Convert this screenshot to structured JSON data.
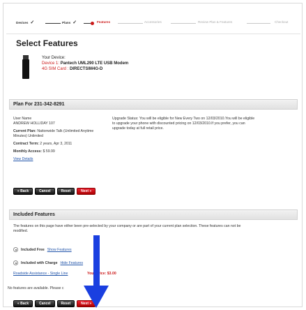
{
  "steps": [
    {
      "label": "Devices",
      "state": "done"
    },
    {
      "label": "Plans",
      "state": "done"
    },
    {
      "label": "Features",
      "state": "active"
    },
    {
      "label": "Accessories",
      "state": "inactive"
    },
    {
      "label": "Review Plan & Features",
      "state": "inactive"
    },
    {
      "label": "Checkout",
      "state": "inactive"
    }
  ],
  "page_title": "Select Features",
  "device": {
    "your_device_label": "Your Device:",
    "device_label": "Device 1:",
    "device_name": "Pantech UML290 LTE USB Modem",
    "sim_label": "4G SIM Card :",
    "sim_value": "DIRECTSIM4G-D"
  },
  "plan_section": {
    "title": "Plan For 231-342-8291",
    "user_name_label": "User Name",
    "user_name_value": "ANDREW HOLLIDAY 107",
    "current_plan_label": "Current Plan:",
    "current_plan_value": "Nationwide Talk (Unlimited Anytime Minutes) Unlimited",
    "contract_label": "Contract Term:",
    "contract_value": "2 years, Apr 3, 2011",
    "access_label": "Monthly Access:",
    "access_value": "$ 59.99",
    "view_details": "View Details",
    "upgrade_text": "Upgrade Status: You will be eligible for New Every Two on 12/03/2010.You will be eligible to upgrade your phone with discounted pricing on 12/03/2010.If you prefer, you can upgrade today at full retail price."
  },
  "buttons": {
    "back": "« Back",
    "cancel": "Cancel",
    "reset": "Reset",
    "next": "Next »"
  },
  "included_section": {
    "title": "Included Features",
    "description": "The features on this page have either been pre-selected by your company or are part of your current plan selection. These features can not be modified.",
    "free_label": "Included Free",
    "free_link": "Show Features",
    "charge_label": "Included with Charge",
    "charge_link": "Hide Features",
    "roadside": "Roadside Assistance - Single Line",
    "roadside_price": "Your Price: $3.00",
    "no_features": "No features are available. Please c"
  },
  "colors": {
    "accent_red": "#cc1a1a",
    "arrow_blue": "#1a3fe0",
    "link_blue": "#2255aa"
  }
}
